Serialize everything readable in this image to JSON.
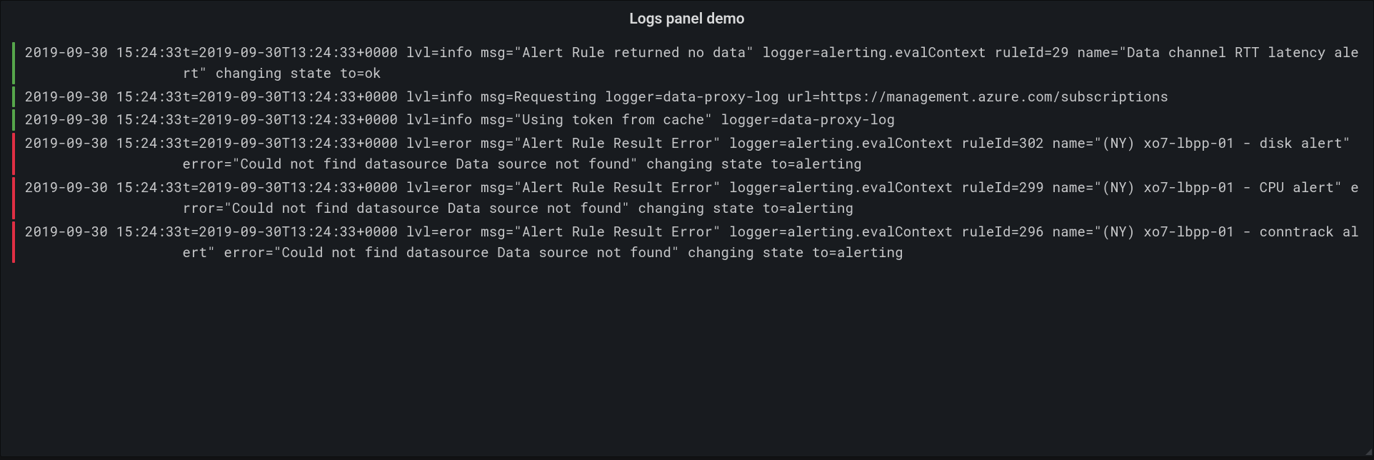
{
  "panel": {
    "title": "Logs panel demo"
  },
  "colors": {
    "info": "#56a64b",
    "error": "#e02f44"
  },
  "logs": [
    {
      "level": "info",
      "timestamp": "2019-09-30 15:24:33",
      "message": "t=2019-09-30T13:24:33+0000 lvl=info msg=\"Alert Rule returned no data\" logger=alerting.evalContext ruleId=29 name=\"Data channel RTT latency alert\" changing state to=ok"
    },
    {
      "level": "info",
      "timestamp": "2019-09-30 15:24:33",
      "message": "t=2019-09-30T13:24:33+0000 lvl=info msg=Requesting logger=data-proxy-log url=https://management.azure.com/subscriptions"
    },
    {
      "level": "info",
      "timestamp": "2019-09-30 15:24:33",
      "message": "t=2019-09-30T13:24:33+0000 lvl=info msg=\"Using token from cache\" logger=data-proxy-log"
    },
    {
      "level": "error",
      "timestamp": "2019-09-30 15:24:33",
      "message": "t=2019-09-30T13:24:33+0000 lvl=eror msg=\"Alert Rule Result Error\" logger=alerting.evalContext ruleId=302 name=\"(NY) xo7-lbpp-01 - disk alert\" error=\"Could not find datasource Data source not found\" changing state to=alerting"
    },
    {
      "level": "error",
      "timestamp": "2019-09-30 15:24:33",
      "message": "t=2019-09-30T13:24:33+0000 lvl=eror msg=\"Alert Rule Result Error\" logger=alerting.evalContext ruleId=299 name=\"(NY) xo7-lbpp-01 - CPU alert\" error=\"Could not find datasource Data source not found\" changing state to=alerting"
    },
    {
      "level": "error",
      "timestamp": "2019-09-30 15:24:33",
      "message": "t=2019-09-30T13:24:33+0000 lvl=eror msg=\"Alert Rule Result Error\" logger=alerting.evalContext ruleId=296 name=\"(NY) xo7-lbpp-01 - conntrack alert\" error=\"Could not find datasource Data source not found\" changing state to=alerting"
    }
  ]
}
